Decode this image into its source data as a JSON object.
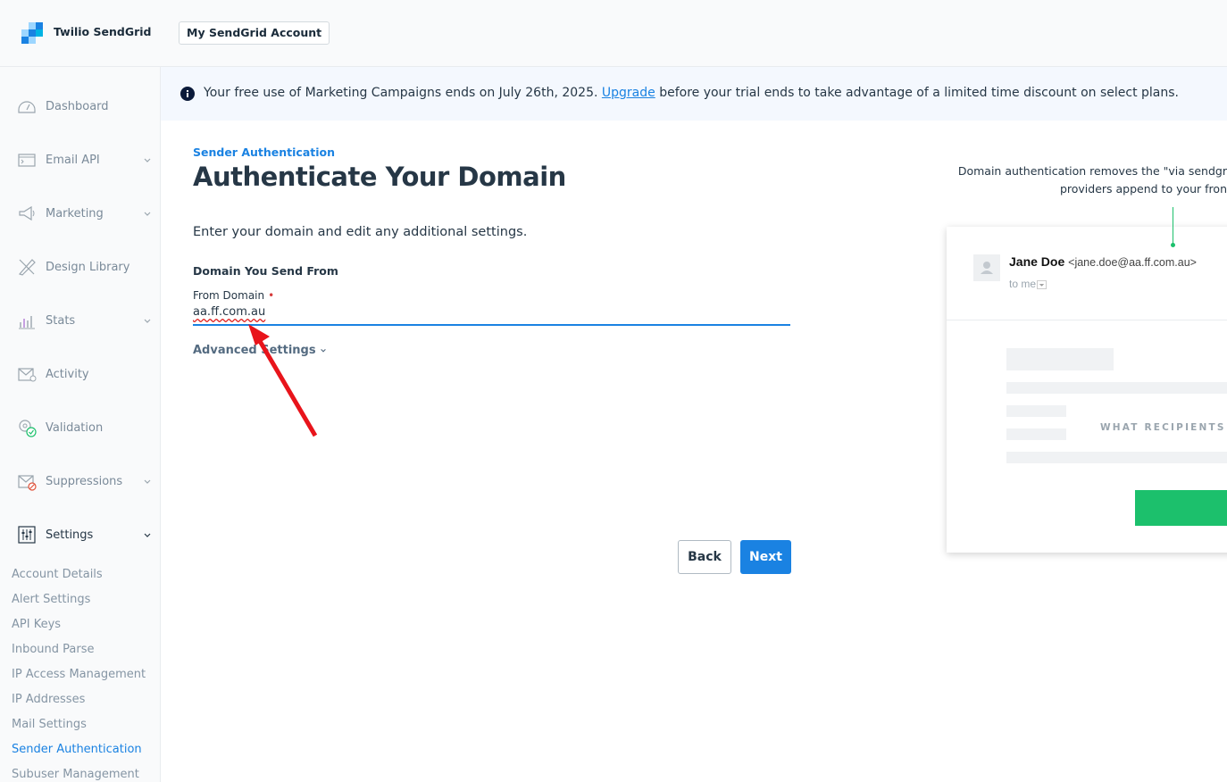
{
  "header": {
    "brand": "Twilio SendGrid",
    "account_button": "My SendGrid Account"
  },
  "sidebar": {
    "items": [
      {
        "label": "Dashboard",
        "icon": "dashboard-icon"
      },
      {
        "label": "Email API",
        "icon": "email-api-icon"
      },
      {
        "label": "Marketing",
        "icon": "megaphone-icon"
      },
      {
        "label": "Design Library",
        "icon": "design-library-icon"
      },
      {
        "label": "Stats",
        "icon": "stats-icon"
      },
      {
        "label": "Activity",
        "icon": "activity-icon"
      },
      {
        "label": "Validation",
        "icon": "validation-icon"
      },
      {
        "label": "Suppressions",
        "icon": "suppressions-icon"
      },
      {
        "label": "Settings",
        "icon": "settings-icon"
      }
    ],
    "settings_sub": [
      "Account Details",
      "Alert Settings",
      "API Keys",
      "Inbound Parse",
      "IP Access Management",
      "IP Addresses",
      "Mail Settings",
      "Sender Authentication",
      "Subuser Management"
    ]
  },
  "banner": {
    "text_before": "Your free use of Marketing Campaigns ends on July 26th, 2025. ",
    "link": "Upgrade",
    "text_after": " before your trial ends to take advantage of a limited time discount on select plans."
  },
  "main": {
    "eyebrow": "Sender Authentication",
    "title": "Authenticate Your Domain",
    "intro": "Enter your domain and edit any additional settings.",
    "section_title": "Domain You Send From",
    "field_label": "From Domain",
    "field_required": "•",
    "field_value": "aa.ff.com.au",
    "advanced": "Advanced Settings",
    "back": "Back",
    "next": "Next"
  },
  "preview": {
    "desc_line1": "Domain authentication removes the \"via sendgr",
    "desc_line2": "providers append to your fron",
    "sender_name": "Jane Doe",
    "sender_email": "<jane.doe@aa.ff.com.au>",
    "to_me": "to me",
    "recipients": "WHAT RECIPIENTS S"
  },
  "colors": {
    "accent": "#1a82e2",
    "green": "#1cc06c",
    "annotation_arrow": "#e8141b"
  }
}
